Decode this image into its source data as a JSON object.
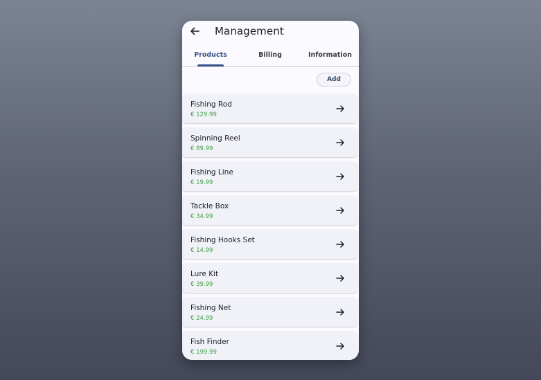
{
  "appbar": {
    "title": "Management",
    "back_icon": "arrow-left-icon"
  },
  "tabs": [
    {
      "label": "Products",
      "active": true
    },
    {
      "label": "Billing",
      "active": false
    },
    {
      "label": "Information",
      "active": false
    }
  ],
  "toolbar": {
    "add_label": "Add"
  },
  "colors": {
    "accent": "#3d5687",
    "price": "#43a047"
  },
  "products": [
    {
      "name": "Fishing Rod",
      "price": "€ 129.99",
      "icon": "arrow-right-icon"
    },
    {
      "name": "Spinning Reel",
      "price": "€ 89.99",
      "icon": "arrow-right-icon"
    },
    {
      "name": "Fishing Line",
      "price": "€ 19.99",
      "icon": "arrow-right-icon"
    },
    {
      "name": "Tackle Box",
      "price": "€ 34.99",
      "icon": "arrow-right-icon"
    },
    {
      "name": "Fishing Hooks Set",
      "price": "€ 14.99",
      "icon": "arrow-right-icon"
    },
    {
      "name": "Lure Kit",
      "price": "€ 39.99",
      "icon": "arrow-right-icon"
    },
    {
      "name": "Fishing Net",
      "price": "€ 24.99",
      "icon": "arrow-right-icon"
    },
    {
      "name": "Fish Finder",
      "price": "€ 199.99",
      "icon": "arrow-right-icon"
    }
  ]
}
